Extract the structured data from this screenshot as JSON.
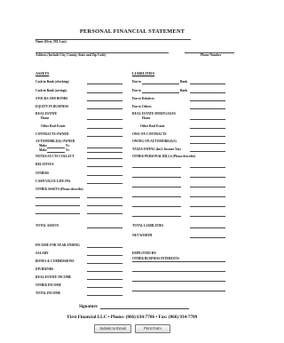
{
  "title": "PERSONAL FINANCIAL STATEMENT",
  "header": {
    "name_label": "Name (First, MI, Last)",
    "address_label": "Address (Include City, County, State and Zip Code)",
    "phone_label": "Phone Number"
  },
  "assets": {
    "heading": "ASSETS",
    "cash_checking": "Cash in Bank (checking)",
    "cash_savings": "Cash in Bank (savings)",
    "stocks_bonds": "STOCKS AND BONDS",
    "equity_business": "EQUITY IN BUSINESS",
    "real_estate": "REAL ESTATE",
    "home": "Home",
    "other_real_estate": "Other Real Estate",
    "contracts_owned": "CONTRACTS OWNED",
    "automobiles_owned": "AUTOMOBILE(S) OWNED",
    "make": "Make",
    "yr": "Yr",
    "notes_accts": "NOTES/ACCTS COLLECT",
    "relatives": "RELATIVES",
    "others": "OTHERS",
    "cash_value_life": "CASH VALUE LIFE INS.",
    "other_assets": "OTHER ASSETS (Please describe)",
    "total_assets": "TOTAL ASSETS"
  },
  "liabilities": {
    "heading": "LIABILITIES",
    "due_to": "Due to",
    "bank": "Bank",
    "due_to_relatives": "Due to Relatives",
    "due_to_others": "Due to Others",
    "mortgages": "REAL ESTATE MORTGAGES",
    "home": "Home",
    "other_real_estate": "Other Real Estate",
    "owe_contracts": "OWE ON CONTRACTS",
    "owing_automobiles": "OWING ON AUTOMOBILE(S)",
    "taxes_owing": "TAXES OWING (Incl. Income Tax)",
    "other_personal_bills": "OTHER PERSONAL BILLS (Please describe)",
    "total_liabilities": "TOTAL LIABILITIES",
    "net_worth": "NET WORTH"
  },
  "income": {
    "heading": "INCOME FOR YEAR ENDING",
    "salary": "SALARY",
    "bonus": "BONUS & COMMISSIONS",
    "dividends": "DIVIDENDS",
    "real_estate_income": "REAL ESTATE INCOME",
    "other_income": "OTHER INCOME",
    "total_income": "TOTAL INCOME"
  },
  "employment": {
    "employed_by": "EMPLOYED BY:",
    "other_business": "OTHER BUSINESS INTERESTS:"
  },
  "signature_label": "Signature",
  "footer": "First Financial LLC  •  Phone: (866) 634-7786  •  Fax: (866) 934-7789",
  "buttons": {
    "submit": "Submit to Email",
    "print": "Print Form"
  }
}
